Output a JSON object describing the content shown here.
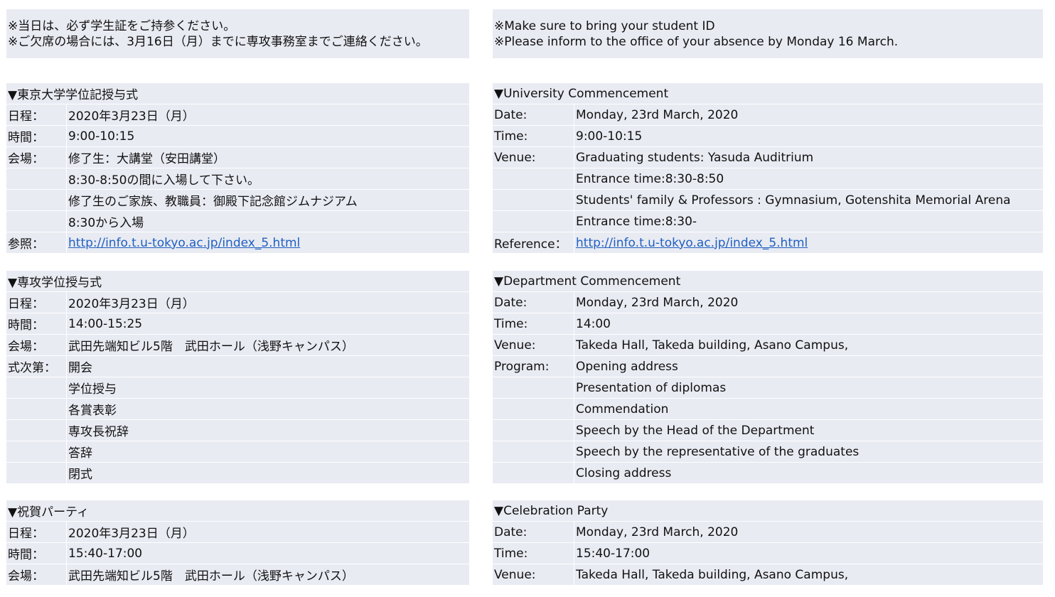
{
  "ja": {
    "notice": [
      "※当日は、必ず学生証をご持参ください。",
      "※ご欠席の場合には、3月16日（月）までに専攻事務室までご連絡ください。"
    ],
    "sections": [
      {
        "title": "▼東京大学学位記授与式",
        "rows": [
          {
            "label": "日程：",
            "value": "2020年3月23日（月）"
          },
          {
            "label": "時間：",
            "value": "9:00-10:15"
          },
          {
            "label": "会場：",
            "value": "修了生：大講堂（安田講堂）"
          },
          {
            "label": "",
            "value": "8:30-8:50の間に入場して下さい。"
          },
          {
            "label": "",
            "value": "修了生のご家族、教職員：御殿下記念館ジムナジアム"
          },
          {
            "label": "",
            "value": "8:30から入場"
          },
          {
            "label": "参照：",
            "value": "http://info.t.u-tokyo.ac.jp/index_5.html",
            "link": true
          }
        ]
      },
      {
        "title": "▼専攻学位授与式",
        "rows": [
          {
            "label": "日程：",
            "value": "2020年3月23日（月）"
          },
          {
            "label": "時間：",
            "value": "14:00-15:25"
          },
          {
            "label": "会場：",
            "value": "武田先端知ビル5階　武田ホール（浅野キャンパス）"
          },
          {
            "label": "式次第：",
            "value": "開会"
          },
          {
            "label": "",
            "value": "学位授与"
          },
          {
            "label": "",
            "value": "各賞表彰"
          },
          {
            "label": "",
            "value": "専攻長祝辞"
          },
          {
            "label": "",
            "value": "答辞"
          },
          {
            "label": "",
            "value": "閉式"
          }
        ]
      },
      {
        "title": "▼祝賀パーティ",
        "rows": [
          {
            "label": "日程：",
            "value": "2020年3月23日（月）"
          },
          {
            "label": "時間：",
            "value": "15:40-17:00"
          },
          {
            "label": "会場：",
            "value": "武田先端知ビル5階　武田ホール（浅野キャンパス）"
          }
        ]
      }
    ]
  },
  "en": {
    "notice": [
      "※Make sure to bring your student ID",
      "※Please inform to the office of your absence by Monday 16 March."
    ],
    "sections": [
      {
        "title": "▼University Commencement",
        "rows": [
          {
            "label": "Date:",
            "value": "Monday, 23rd March, 2020"
          },
          {
            "label": "Time:",
            "value": "9:00-10:15"
          },
          {
            "label": "Venue:",
            "value": "Graduating students: Yasuda Auditrium"
          },
          {
            "label": "",
            "value": "Entrance time:8:30-8:50"
          },
          {
            "label": "",
            "value": "Students' family & Professors : Gymnasium, Gotenshita Memorial Arena"
          },
          {
            "label": "",
            "value": "Entrance time:8:30-"
          },
          {
            "label": "Reference：",
            "value": "http://info.t.u-tokyo.ac.jp/index_5.html",
            "link": true
          }
        ]
      },
      {
        "title": "▼Department Commencement",
        "rows": [
          {
            "label": "Date:",
            "value": "Monday, 23rd March, 2020"
          },
          {
            "label": "Time:",
            "value": "14:00"
          },
          {
            "label": "Venue:",
            "value": "Takeda Hall, Takeda building, Asano Campus,"
          },
          {
            "label": "Program:",
            "value": "Opening address"
          },
          {
            "label": "",
            "value": "Presentation of diplomas"
          },
          {
            "label": "",
            "value": "Commendation"
          },
          {
            "label": "",
            "value": "Speech by the Head of the Department"
          },
          {
            "label": "",
            "value": "Speech by the representative of the graduates"
          },
          {
            "label": "",
            "value": "Closing address"
          }
        ]
      },
      {
        "title": "▼Celebration Party",
        "rows": [
          {
            "label": "Date:",
            "value": "Monday, 23rd March, 2020"
          },
          {
            "label": "Time:",
            "value": "15:40-17:00"
          },
          {
            "label": "Venue:",
            "value": "Takeda Hall, Takeda building, Asano Campus,"
          }
        ]
      }
    ]
  }
}
